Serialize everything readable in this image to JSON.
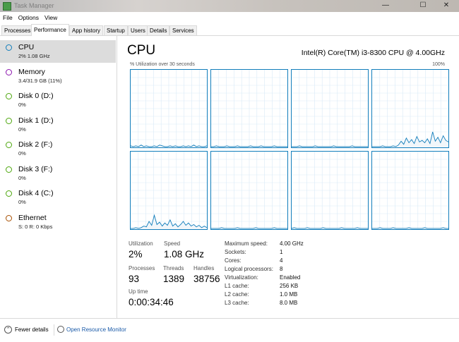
{
  "window": {
    "title": "Task Manager",
    "minimize": "—",
    "maximize": "☐",
    "close": "✕"
  },
  "menu": [
    "File",
    "Options",
    "View"
  ],
  "tabs": [
    "Processes",
    "Performance",
    "App history",
    "Startup",
    "Users",
    "Details",
    "Services"
  ],
  "sidebar": [
    {
      "name": "CPU",
      "sub": "2% 1.08 GHz",
      "color": "#117dbb"
    },
    {
      "name": "Memory",
      "sub": "3.4/31.9 GB (11%)",
      "color": "#8b12ae"
    },
    {
      "name": "Disk 0 (D:)",
      "sub": "0%",
      "color": "#4da60c"
    },
    {
      "name": "Disk 1 (D:)",
      "sub": "0%",
      "color": "#4da60c"
    },
    {
      "name": "Disk 2 (F:)",
      "sub": "0%",
      "color": "#4da60c"
    },
    {
      "name": "Disk 3 (F:)",
      "sub": "0%",
      "color": "#4da60c"
    },
    {
      "name": "Disk 4 (C:)",
      "sub": "0%",
      "color": "#4da60c"
    },
    {
      "name": "Ethernet",
      "sub": "S: 0 R: 0 Kbps",
      "color": "#a74f01"
    }
  ],
  "main": {
    "title": "CPU",
    "cpu_name": "Intel(R) Core(TM) i3-8300 CPU @ 4.00GHz",
    "graph_caption": "% Utilization over 30 seconds",
    "graph_max": "100%",
    "graph_color": "#117dbb"
  },
  "chart_data": {
    "type": "area",
    "title": "% Utilization over 30 seconds",
    "ylim": [
      0,
      100
    ],
    "series": [
      {
        "values": [
          2,
          1,
          2,
          1,
          3,
          1,
          2,
          1,
          1,
          2,
          1,
          3,
          2,
          1,
          1,
          2,
          1,
          2,
          1,
          1,
          2,
          1,
          2,
          1,
          3,
          1,
          2,
          1,
          1,
          2
        ]
      },
      {
        "values": [
          1,
          1,
          2,
          1,
          1,
          1,
          2,
          1,
          1,
          1,
          2,
          1,
          1,
          1,
          1,
          2,
          1,
          1,
          1,
          2,
          1,
          1,
          1,
          1,
          2,
          1,
          1,
          1,
          1,
          1
        ]
      },
      {
        "values": [
          1,
          1,
          1,
          2,
          1,
          1,
          1,
          1,
          1,
          2,
          1,
          1,
          1,
          1,
          1,
          1,
          2,
          1,
          1,
          1,
          1,
          1,
          1,
          2,
          1,
          1,
          1,
          1,
          1,
          1
        ]
      },
      {
        "values": [
          1,
          1,
          1,
          1,
          2,
          1,
          1,
          1,
          2,
          1,
          3,
          8,
          4,
          12,
          6,
          10,
          5,
          14,
          7,
          9,
          6,
          11,
          5,
          20,
          8,
          13,
          6,
          15,
          9,
          7
        ]
      },
      {
        "values": [
          1,
          1,
          2,
          1,
          2,
          4,
          3,
          10,
          5,
          18,
          6,
          9,
          4,
          8,
          5,
          12,
          4,
          7,
          3,
          6,
          10,
          5,
          8,
          4,
          6,
          3,
          5,
          2,
          4,
          2
        ]
      },
      {
        "values": [
          1,
          1,
          1,
          1,
          2,
          1,
          1,
          1,
          1,
          1,
          2,
          1,
          1,
          1,
          1,
          1,
          1,
          2,
          1,
          1,
          1,
          1,
          1,
          1,
          2,
          1,
          1,
          1,
          1,
          1
        ]
      },
      {
        "values": [
          1,
          2,
          1,
          1,
          1,
          1,
          2,
          1,
          1,
          1,
          1,
          1,
          2,
          1,
          1,
          1,
          1,
          1,
          1,
          2,
          1,
          1,
          1,
          1,
          1,
          2,
          1,
          1,
          1,
          1
        ]
      },
      {
        "values": [
          1,
          1,
          1,
          2,
          1,
          1,
          1,
          1,
          2,
          1,
          1,
          1,
          1,
          1,
          2,
          1,
          1,
          1,
          1,
          1,
          2,
          1,
          1,
          1,
          1,
          1,
          1,
          2,
          1,
          1
        ]
      }
    ]
  },
  "stats": {
    "utilization_label": "Utilization",
    "utilization": "2%",
    "speed_label": "Speed",
    "speed": "1.08 GHz",
    "processes_label": "Processes",
    "processes": "93",
    "threads_label": "Threads",
    "threads": "1389",
    "handles_label": "Handles",
    "handles": "38756",
    "uptime_label": "Up time",
    "uptime": "0:00:34:46"
  },
  "details": [
    {
      "label": "Maximum speed:",
      "value": "4.00 GHz"
    },
    {
      "label": "Sockets:",
      "value": "1"
    },
    {
      "label": "Cores:",
      "value": "4"
    },
    {
      "label": "Logical processors:",
      "value": "8"
    },
    {
      "label": "Virtualization:",
      "value": "Enabled"
    },
    {
      "label": "L1 cache:",
      "value": "256 KB"
    },
    {
      "label": "L2 cache:",
      "value": "1.0 MB"
    },
    {
      "label": "L3 cache:",
      "value": "8.0 MB"
    }
  ],
  "footer": {
    "fewer_details": "Fewer details",
    "open_rm": "Open Resource Monitor",
    "chevron": "⌃"
  }
}
